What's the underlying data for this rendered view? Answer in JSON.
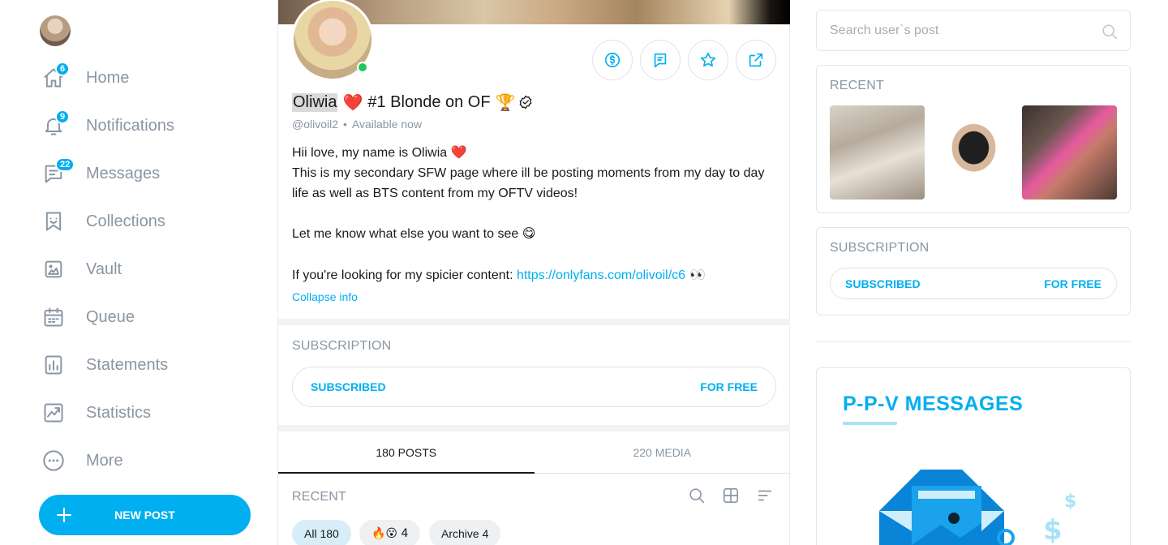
{
  "sidebar": {
    "items": [
      {
        "label": "Home",
        "icon": "home-icon",
        "badge": "6"
      },
      {
        "label": "Notifications",
        "icon": "bell-icon",
        "badge": "9"
      },
      {
        "label": "Messages",
        "icon": "message-icon",
        "badge": "22"
      },
      {
        "label": "Collections",
        "icon": "collections-icon",
        "badge": null
      },
      {
        "label": "Vault",
        "icon": "vault-icon",
        "badge": null
      },
      {
        "label": "Queue",
        "icon": "calendar-icon",
        "badge": null
      },
      {
        "label": "Statements",
        "icon": "statements-icon",
        "badge": null
      },
      {
        "label": "Statistics",
        "icon": "statistics-icon",
        "badge": null
      },
      {
        "label": "More",
        "icon": "more-icon",
        "badge": null
      }
    ],
    "new_post_label": "NEW POST"
  },
  "profile": {
    "name": "Oliwia",
    "title_rest": "#1 Blonde on OF",
    "emoji_heart": "❤️",
    "emoji_trophy": "🏆",
    "handle": "@olivoil2",
    "separator": "•",
    "availability": "Available now",
    "bio_line1": "Hii love, my name is Oliwia ❤️",
    "bio_line2": "This is my secondary SFW page where ill be posting moments from my day to day life as well as BTS content from my OFTV videos!",
    "bio_line3": "Let me know what else you want to see 😋",
    "bio_line4_prefix": "If you're looking for my spicier content: ",
    "bio_link": "https://onlyfans.com/olivoil/c6",
    "bio_line4_suffix": " 👀",
    "collapse_label": "Collapse info"
  },
  "subscription": {
    "section_label": "SUBSCRIPTION",
    "status": "SUBSCRIBED",
    "price": "FOR FREE"
  },
  "tabs": [
    {
      "label": "180 POSTS",
      "active": true
    },
    {
      "label": "220 MEDIA",
      "active": false
    }
  ],
  "feed": {
    "section_label": "RECENT",
    "chips": [
      {
        "label": "All 180",
        "active": true
      },
      {
        "label": "🔥😮 4",
        "active": false
      },
      {
        "label": "Archive 4",
        "active": false
      }
    ]
  },
  "right": {
    "search_placeholder": "Search user`s post",
    "recent_label": "RECENT",
    "subscription_label": "SUBSCRIPTION",
    "subscription_status": "SUBSCRIBED",
    "subscription_price": "FOR FREE",
    "promo_title": "P-P-V  MESSAGES"
  },
  "colors": {
    "accent": "#00aff0",
    "muted": "#8a96a3",
    "online": "#22c55e"
  }
}
